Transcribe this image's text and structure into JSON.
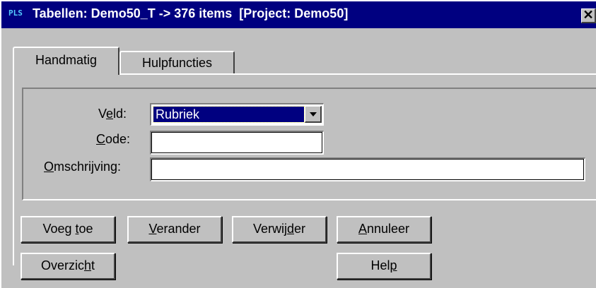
{
  "window": {
    "app_icon": "PLS",
    "title": "Tabellen: Demo50_T -> 376 items  [Project: Demo50]",
    "close_glyph": "✕"
  },
  "tabs": [
    {
      "label": "Handmatig",
      "active": true
    },
    {
      "label": "Hulpfuncties",
      "active": false
    }
  ],
  "form": {
    "veld": {
      "label_pre": "V",
      "label_u": "e",
      "label_post": "ld:",
      "value": "Rubriek"
    },
    "code": {
      "label_pre": "",
      "label_u": "C",
      "label_post": "ode:",
      "value": ""
    },
    "omschrijving": {
      "label_pre": "",
      "label_u": "O",
      "label_post": "mschrijving:",
      "value": ""
    }
  },
  "buttons": {
    "voeg_toe": {
      "pre": "Voeg ",
      "u": "t",
      "post": "oe"
    },
    "verander": {
      "pre": "",
      "u": "V",
      "post": "erander"
    },
    "verwijder": {
      "pre": "Verwij",
      "u": "d",
      "post": "er"
    },
    "annuleer": {
      "pre": "",
      "u": "A",
      "post": "nnuleer"
    },
    "overzicht": {
      "pre": "Overzic",
      "u": "h",
      "post": "t"
    },
    "help": {
      "pre": "Hel",
      "u": "p",
      "post": ""
    }
  },
  "colors": {
    "titlebar": "#000080",
    "face": "#c0c0c0",
    "selection": "#000080"
  }
}
